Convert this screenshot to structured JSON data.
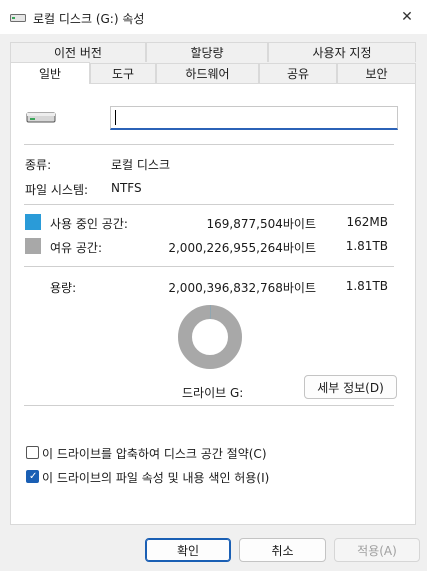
{
  "window": {
    "title": "로컬 디스크 (G:) 속성",
    "close_icon": "close-icon"
  },
  "tabs_row1": [
    {
      "label": "이전 버전"
    },
    {
      "label": "할당량"
    },
    {
      "label": "사용자 지정"
    }
  ],
  "tabs_row2": [
    {
      "label": "일반",
      "active": true
    },
    {
      "label": "도구"
    },
    {
      "label": "하드웨어"
    },
    {
      "label": "공유"
    },
    {
      "label": "보안"
    }
  ],
  "general": {
    "drive_icon": "drive-icon",
    "name_value": "",
    "type_label": "종류:",
    "type_value": "로컬 디스크",
    "fs_label": "파일 시스템:",
    "fs_value": "NTFS",
    "used": {
      "label": "사용 중인 공간:",
      "bytes": "169,877,504바이트",
      "size": "162MB",
      "color": "#2a9bd8"
    },
    "free": {
      "label": "여유 공간:",
      "bytes": "2,000,226,955,264바이트",
      "size": "1.81TB",
      "color": "#a8a8a8"
    },
    "capacity": {
      "label": "용량:",
      "bytes": "2,000,396,832,768바이트",
      "size": "1.81TB"
    },
    "drive_label": "드라이브 G:",
    "details_button": "세부 정보(D)",
    "compress_checkbox": {
      "label": "이 드라이브를 압축하여 디스크 공간 절약(C)",
      "checked": false
    },
    "index_checkbox": {
      "label": "이 드라이브의 파일 속성 및 내용 색인 허용(I)",
      "checked": true
    }
  },
  "footer": {
    "ok_button": "확인",
    "cancel_button": "취소",
    "apply_button": "적용(A)"
  }
}
